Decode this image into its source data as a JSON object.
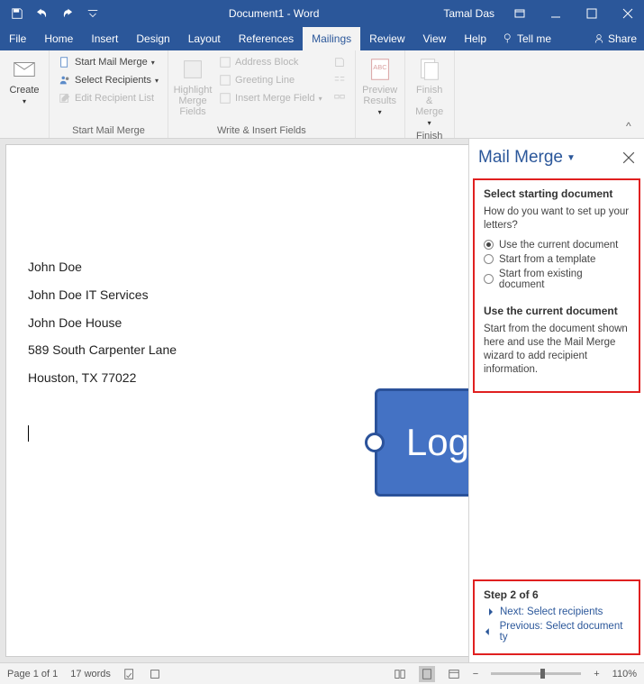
{
  "titlebar": {
    "doc_title": "Document1 - Word",
    "user": "Tamal Das"
  },
  "tabs": {
    "file": "File",
    "home": "Home",
    "insert": "Insert",
    "design": "Design",
    "layout": "Layout",
    "references": "References",
    "mailings": "Mailings",
    "review": "Review",
    "view": "View",
    "help": "Help",
    "tell_me": "Tell me",
    "share": "Share"
  },
  "ribbon": {
    "create": "Create",
    "start_mail_merge": "Start Mail Merge",
    "select_recipients": "Select Recipients",
    "edit_recipient_list": "Edit Recipient List",
    "group_start": "Start Mail Merge",
    "highlight_merge_fields": "Highlight\nMerge Fields",
    "address_block": "Address Block",
    "greeting_line": "Greeting Line",
    "insert_merge_field": "Insert Merge Field",
    "group_write": "Write & Insert Fields",
    "preview_results": "Preview\nResults",
    "finish_merge": "Finish &\nMerge",
    "group_finish": "Finish"
  },
  "document": {
    "lines": [
      "John Doe",
      "John Doe IT Services",
      "John Doe House",
      "589 South Carpenter Lane",
      "Houston, TX 77022"
    ],
    "logo_text": "Log"
  },
  "taskpane": {
    "title": "Mail Merge",
    "sec1_h": "Select starting document",
    "sec1_q": "How do you want to set up your letters?",
    "opt1": "Use the current document",
    "opt2": "Start from a template",
    "opt3": "Start from existing document",
    "sec2_h": "Use the current document",
    "sec2_p": "Start from the document shown here and use the Mail Merge wizard to add recipient information.",
    "step": "Step 2 of 6",
    "next": "Next: Select recipients",
    "prev": "Previous: Select document ty"
  },
  "statusbar": {
    "page": "Page 1 of 1",
    "words": "17 words",
    "zoom": "110%"
  }
}
